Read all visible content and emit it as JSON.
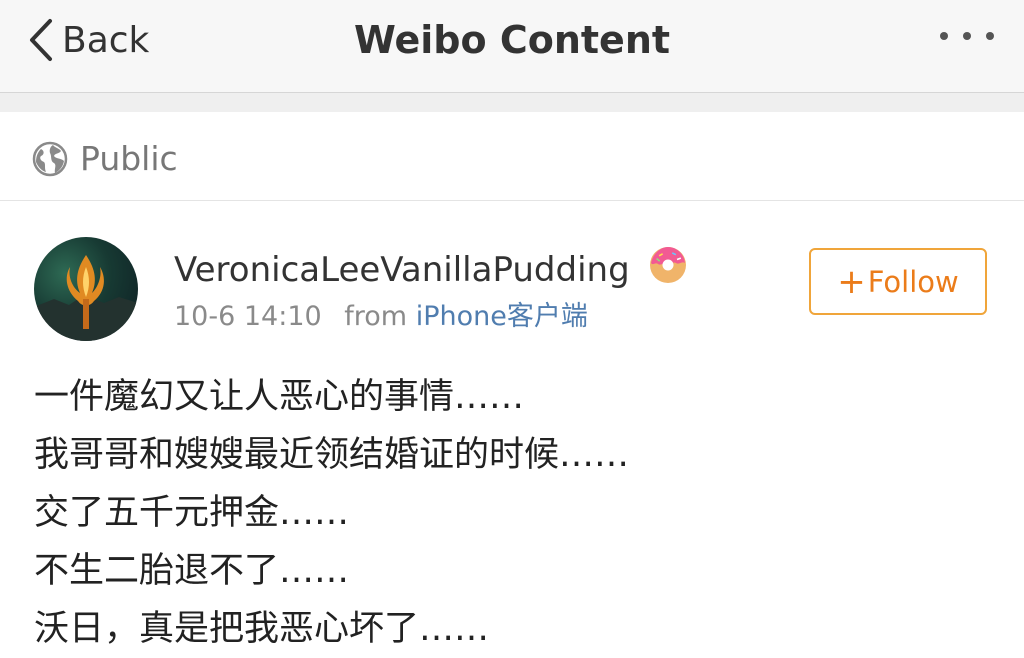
{
  "navbar": {
    "back_label": "Back",
    "title": "Weibo Content",
    "more_icon": "more-icon"
  },
  "visibility": {
    "label": "Public",
    "icon": "globe-icon"
  },
  "post": {
    "author": {
      "name": "VeronicaLeeVanillaPudding",
      "badge_icon": "donut-icon"
    },
    "timestamp": "10-6 14:10",
    "from_label": "from",
    "source": "iPhone客户端",
    "follow_label": "Follow",
    "lines": [
      "一件魔幻又让人恶心的事情……",
      "我哥哥和嫂嫂最近领结婚证的时候……",
      "交了五千元押金……",
      "不生二胎退不了……",
      "沃日，真是把我恶心坏了……"
    ]
  },
  "colors": {
    "accent_orange": "#eb7c1a",
    "follow_border": "#f0a53a",
    "link_blue": "#507daf",
    "meta_gray": "#8a8a8a"
  }
}
